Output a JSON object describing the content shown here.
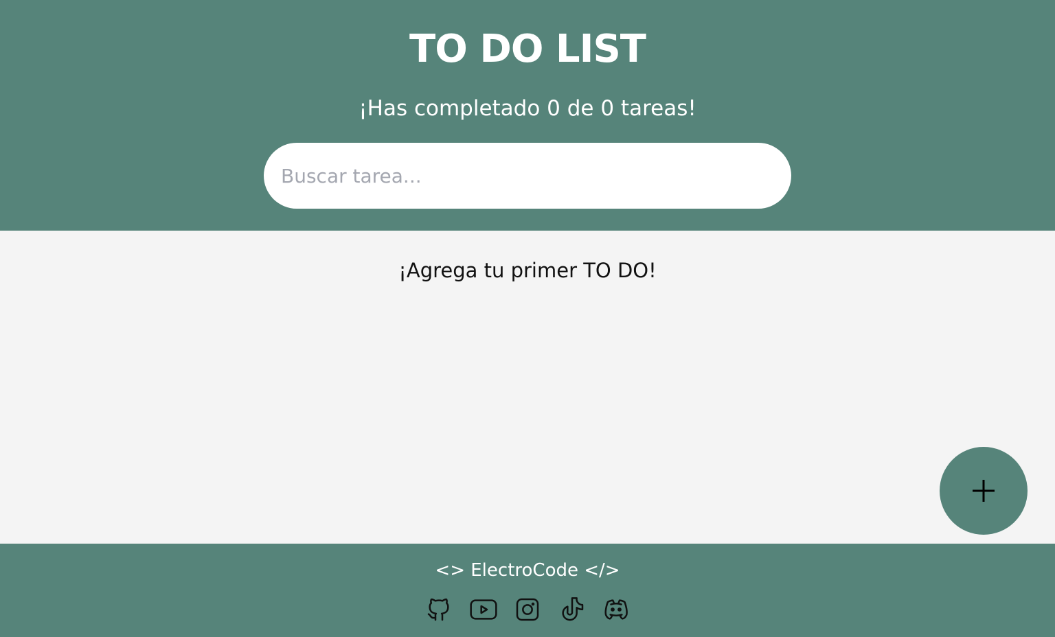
{
  "header": {
    "title": "TO DO LIST",
    "counter": "¡Has completado 0 de 0 tareas!",
    "search_placeholder": "Buscar tarea...",
    "search_value": ""
  },
  "main": {
    "empty_message": "¡Agrega tu primer TO DO!"
  },
  "fab": {
    "icon": "plus-icon"
  },
  "footer": {
    "brand": "<> ElectroCode </>",
    "socials": [
      {
        "icon": "github-icon"
      },
      {
        "icon": "youtube-icon"
      },
      {
        "icon": "instagram-icon"
      },
      {
        "icon": "tiktok-icon"
      },
      {
        "icon": "discord-icon"
      }
    ]
  },
  "colors": {
    "primary": "#56847a",
    "background": "#f4f4f4",
    "surface": "#ffffff",
    "text": "#111111",
    "placeholder": "#a4a7b0"
  }
}
